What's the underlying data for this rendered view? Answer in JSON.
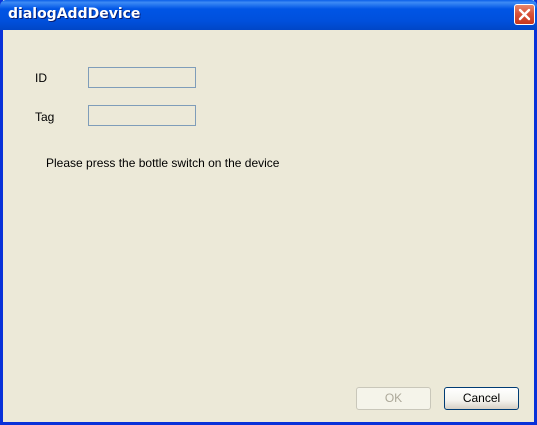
{
  "window": {
    "title": "dialogAddDevice",
    "close_icon": "close-icon"
  },
  "form": {
    "id_label": "ID",
    "id_value": "",
    "tag_label": "Tag",
    "tag_value": ""
  },
  "message": "Please press the bottle switch on the device",
  "buttons": {
    "ok_label": "OK",
    "ok_enabled": false,
    "cancel_label": "Cancel"
  },
  "colors": {
    "titlebar": "#0055E5",
    "window_bg": "#ECE9D8",
    "close_button": "#D8533A",
    "textbox_border": "#7F9DB9"
  }
}
